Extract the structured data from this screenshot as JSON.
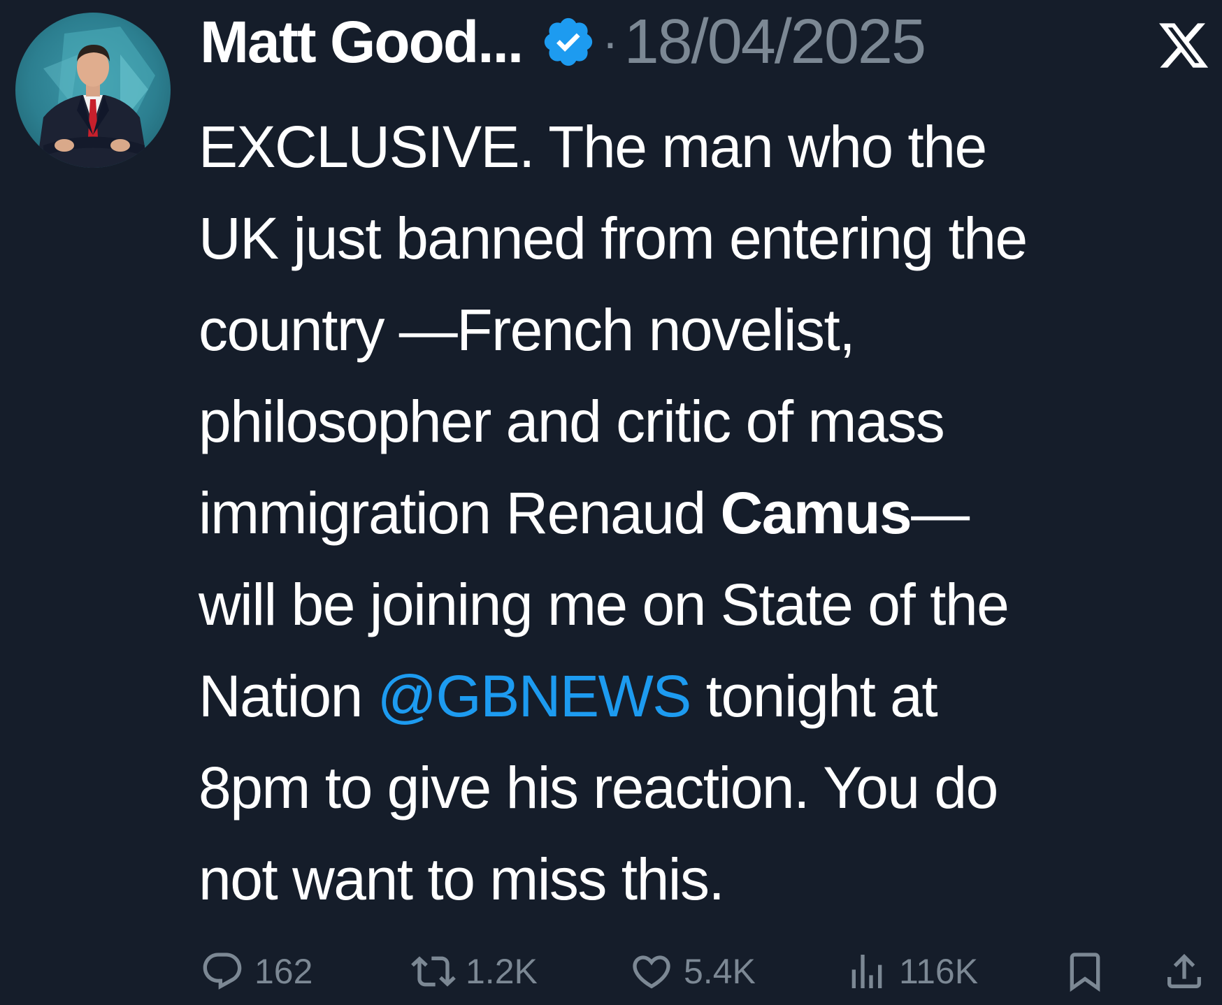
{
  "author": {
    "display_name": "Matt Good...",
    "verified": true,
    "separator": "·",
    "date": "18/04/2025"
  },
  "platform": {
    "logo": "x-logo-icon"
  },
  "tweet": {
    "lines": {
      "l1": "EXCLUSIVE. The man who the",
      "l2": "UK just banned from entering the",
      "l3": "country —French novelist,",
      "l4": "philosopher and critic of mass",
      "l5a": "immigration Renaud ",
      "l5b": "Camus",
      "l5c": "—",
      "l6": "will be joining me on State of the",
      "l7a": "Nation ",
      "l7b": "@GBNEWS",
      "l7c": " tonight at",
      "l8": "8pm to give his reaction. You do",
      "l9": "not want to miss this."
    }
  },
  "actions": {
    "replies": "162",
    "reposts": "1.2K",
    "likes": "5.4K",
    "views": "116K"
  },
  "colors": {
    "background": "#151d2a",
    "text": "#ffffff",
    "muted": "#7c8894",
    "link": "#1d9bf0",
    "verified": "#1d9bf0"
  }
}
